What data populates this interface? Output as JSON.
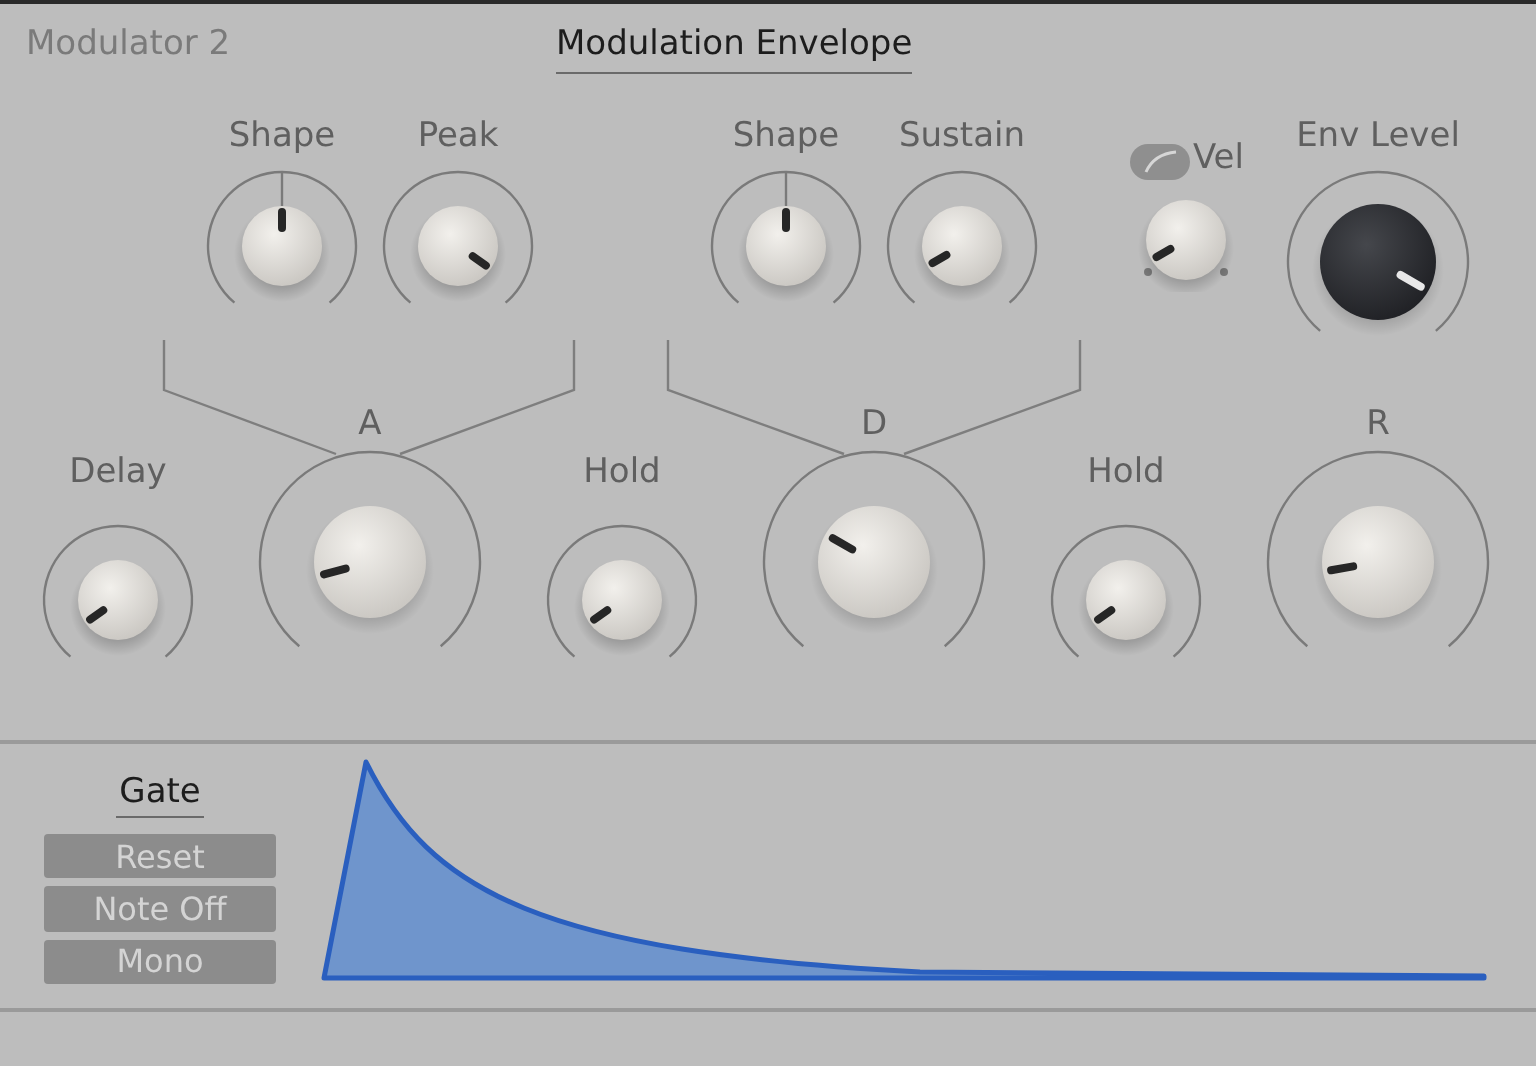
{
  "header": {
    "module": "Modulator 2",
    "title": "Modulation Envelope"
  },
  "top_knobs": [
    {
      "label": "Shape",
      "kind": "center"
    },
    {
      "label": "Peak",
      "kind": "plain"
    },
    {
      "label": "Shape",
      "kind": "center"
    },
    {
      "label": "Sustain",
      "kind": "plain"
    },
    {
      "label": "Vel",
      "kind": "dotted"
    },
    {
      "label": "Env Level",
      "kind": "dark"
    }
  ],
  "bottom_knobs": [
    {
      "label": "Delay",
      "kind": "plain"
    },
    {
      "label": "A",
      "kind": "large"
    },
    {
      "label": "Hold",
      "kind": "plain"
    },
    {
      "label": "D",
      "kind": "large"
    },
    {
      "label": "Hold",
      "kind": "plain"
    },
    {
      "label": "R",
      "kind": "large"
    }
  ],
  "gate": {
    "label": "Gate",
    "buttons": [
      {
        "label": "Reset",
        "selected": false
      },
      {
        "label": "Note Off",
        "selected": false
      },
      {
        "label": "Mono",
        "selected": false
      }
    ]
  }
}
